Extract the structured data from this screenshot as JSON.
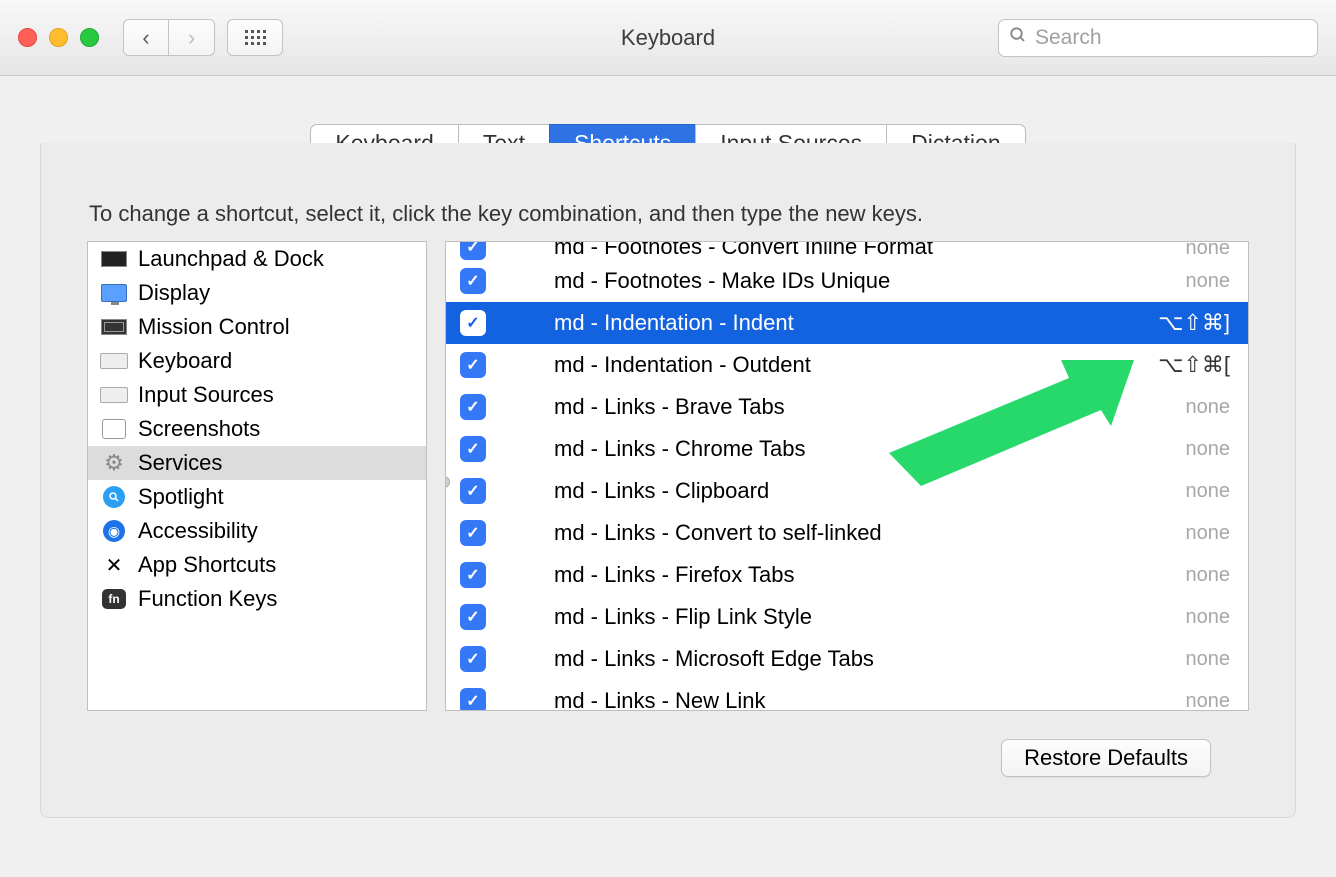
{
  "window": {
    "title": "Keyboard",
    "searchPlaceholder": "Search"
  },
  "tabs": [
    "Keyboard",
    "Text",
    "Shortcuts",
    "Input Sources",
    "Dictation"
  ],
  "activeTab": "Shortcuts",
  "instruction": "To change a shortcut, select it, click the key combination, and then type the new keys.",
  "sidebar": [
    {
      "label": "Launchpad & Dock",
      "icon": "launchpad-dock"
    },
    {
      "label": "Display",
      "icon": "display"
    },
    {
      "label": "Mission Control",
      "icon": "mission-control"
    },
    {
      "label": "Keyboard",
      "icon": "keyboard"
    },
    {
      "label": "Input Sources",
      "icon": "input-sources"
    },
    {
      "label": "Screenshots",
      "icon": "screenshots"
    },
    {
      "label": "Services",
      "icon": "services",
      "selected": true
    },
    {
      "label": "Spotlight",
      "icon": "spotlight"
    },
    {
      "label": "Accessibility",
      "icon": "accessibility"
    },
    {
      "label": "App Shortcuts",
      "icon": "app-shortcuts"
    },
    {
      "label": "Function Keys",
      "icon": "function-keys"
    }
  ],
  "services": [
    {
      "checked": true,
      "label": "md - Footnotes - Convert Inline Format",
      "shortcut": "none",
      "clippedTop": true
    },
    {
      "checked": true,
      "label": "md - Footnotes - Make IDs Unique",
      "shortcut": "none"
    },
    {
      "checked": true,
      "label": "md - Indentation - Indent",
      "shortcut": "⌥⇧⌘]",
      "keys": true,
      "selected": true
    },
    {
      "checked": true,
      "label": "md - Indentation - Outdent",
      "shortcut": "⌥⇧⌘[",
      "keys": true
    },
    {
      "checked": true,
      "label": "md - Links - Brave Tabs",
      "shortcut": "none"
    },
    {
      "checked": true,
      "label": "md - Links - Chrome Tabs",
      "shortcut": "none"
    },
    {
      "checked": true,
      "label": "md - Links - Clipboard",
      "shortcut": "none"
    },
    {
      "checked": true,
      "label": "md - Links - Convert to self-linked",
      "shortcut": "none"
    },
    {
      "checked": true,
      "label": "md - Links - Firefox Tabs",
      "shortcut": "none"
    },
    {
      "checked": true,
      "label": "md - Links - Flip Link Style",
      "shortcut": "none"
    },
    {
      "checked": true,
      "label": "md - Links - Microsoft Edge Tabs",
      "shortcut": "none"
    },
    {
      "checked": true,
      "label": "md - Links - New Link",
      "shortcut": "none"
    }
  ],
  "restoreDefaults": "Restore Defaults"
}
